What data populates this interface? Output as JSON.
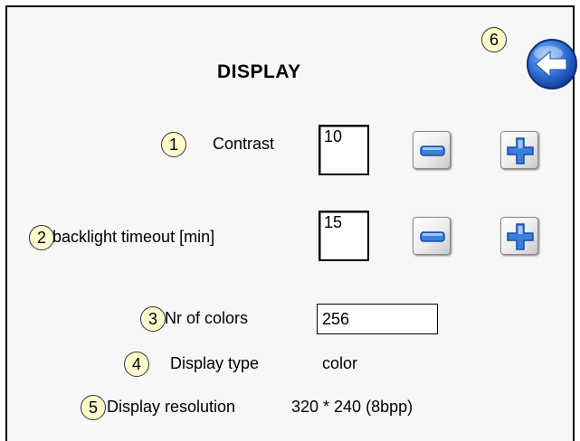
{
  "title": "DISPLAY",
  "back_button": {
    "badge": "6",
    "icon": "arrow-left-icon"
  },
  "contrast": {
    "badge": "1",
    "label": "Contrast",
    "value": "10",
    "minus_icon": "minus-icon",
    "plus_icon": "plus-icon"
  },
  "backlight": {
    "badge": "2",
    "label": "backlight timeout [min]",
    "value": "15",
    "minus_icon": "minus-icon",
    "plus_icon": "plus-icon"
  },
  "colors": {
    "badge": "3",
    "label": "Nr of colors",
    "value": "256"
  },
  "display_type": {
    "badge": "4",
    "label": "Display type",
    "value": "color"
  },
  "resolution": {
    "badge": "5",
    "label": "Display resolution",
    "value": "320 * 240 (8bpp)"
  },
  "accent": {
    "badge_fill": "#fffacc",
    "button_blue": "#3a7fd9"
  }
}
